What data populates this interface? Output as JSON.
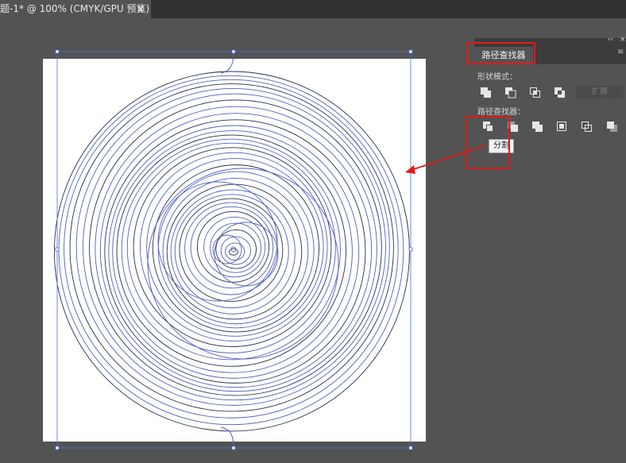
{
  "document_tab": {
    "title": "题-1* @ 100% (CMYK/GPU 预览)",
    "close_glyph": "×"
  },
  "pathfinder_panel": {
    "tab_label": "路径查找器",
    "collapse_glyph": "‹‹",
    "close_glyph": "×",
    "menu_glyph": "≡",
    "shape_modes_label": "形状模式：",
    "shape_mode_buttons": [
      "unite-icon",
      "minus-front-icon",
      "intersect-icon",
      "exclude-icon"
    ],
    "expand_label": "扩展",
    "pathfinders_label": "路径查找器：",
    "pathfinder_buttons": [
      "divide-icon",
      "trim-icon",
      "merge-icon",
      "crop-icon",
      "outline-icon",
      "minus-back-icon"
    ]
  },
  "tooltip": {
    "text": "分割"
  },
  "colors": {
    "workspace": "#535353",
    "path_stroke": "#5060c0",
    "selection": "#4a6fd8",
    "annotation": "#e21b1b"
  }
}
